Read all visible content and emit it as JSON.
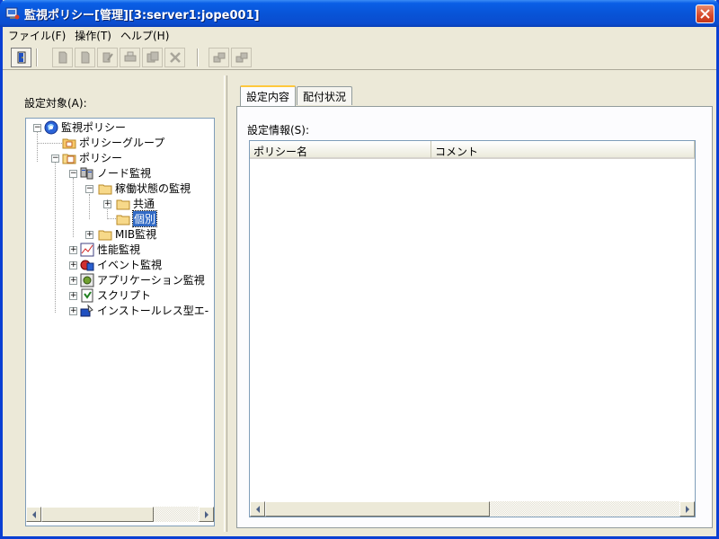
{
  "window": {
    "title": "監視ポリシー[管理][3:server1:jope001]"
  },
  "menu": [
    {
      "label": "ファイル(F)"
    },
    {
      "label": "操作(T)"
    },
    {
      "label": "ヘルプ(H)"
    }
  ],
  "left_pane": {
    "label": "設定対象(A):"
  },
  "tree": {
    "root": "監視ポリシー",
    "policy_group": "ポリシーグループ",
    "policy": "ポリシー",
    "node_monitor": "ノード監視",
    "operation_monitor": "稼働状態の監視",
    "common": "共通",
    "individual": "個別",
    "mib_monitor": "MIB監視",
    "perf_monitor": "性能監視",
    "event_monitor": "イベント監視",
    "app_monitor": "アプリケーション監視",
    "script": "スクリプト",
    "installless": "インストールレス型エ-"
  },
  "tabs": [
    {
      "label": "設定内容",
      "active": true
    },
    {
      "label": "配付状況",
      "active": false
    }
  ],
  "right_pane": {
    "label": "設定情報(S):",
    "columns": [
      "ポリシー名",
      "コメント"
    ]
  },
  "colors": {
    "titlebar": "#0854d7",
    "selection": "#316ac5",
    "window_bg": "#ece9d8"
  }
}
